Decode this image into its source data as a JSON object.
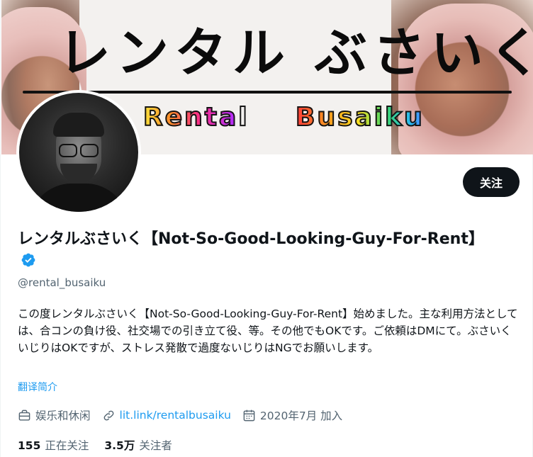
{
  "banner": {
    "title": "レンタル ぶさいく",
    "subtitle_left": "Rental",
    "subtitle_right": "Busaiku"
  },
  "profile": {
    "display_name": "レンタルぶさいく【Not-So-Good-Looking-Guy-For-Rent】",
    "handle": "@rental_busaiku",
    "verified": true,
    "follow_label": "关注",
    "bio": "この度レンタルぶさいく【Not-So-Good-Looking-Guy-For-Rent】始めました。主な利用方法としては、合コンの負け役、社交場での引き立て役、等。その他でもOKです。ご依頼はDMにて。ぶさいくいじりはOKですが、ストレス発散で過度ないじりはNGでお願いします。",
    "translate_label": "翻译简介"
  },
  "meta": {
    "category": "娱乐和休闲",
    "link": "lit.link/rentalbusaiku",
    "joined": "2020年7月 加入"
  },
  "stats": {
    "following_count": "155",
    "following_label": "正在关注",
    "followers_count": "3.5万",
    "followers_label": "关注者"
  },
  "colors": {
    "accent": "#1d9bf0",
    "text_primary": "#0f1419",
    "text_secondary": "#536471",
    "button_bg": "#0f1419"
  },
  "icons": {
    "verified": "verified-badge-icon",
    "category": "briefcase-icon",
    "link": "link-icon",
    "joined": "calendar-icon"
  }
}
